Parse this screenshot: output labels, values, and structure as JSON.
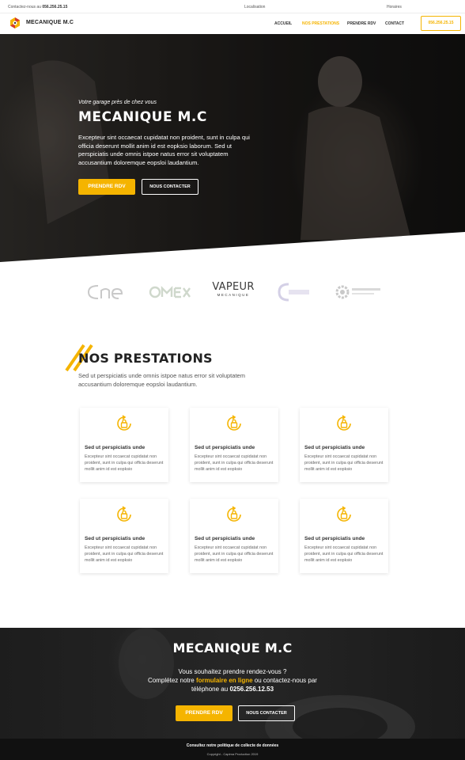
{
  "topbar": {
    "contact_prefix": "Contactez-nous au",
    "contact_phone": "056.256.25.15",
    "location": "Localisation",
    "hours": "Horaires"
  },
  "brand": {
    "name": "MECANIQUE M.C"
  },
  "nav": {
    "items": [
      "ACCUEIL",
      "NOS PRESTATIONS",
      "PRENDRE RDV",
      "CONTACT"
    ],
    "active": "NOS PRESTATIONS",
    "phone": "056.256.25.15"
  },
  "hero": {
    "kicker": "Votre garage près de chez vous",
    "title": "MECANIQUE M.C",
    "text": "Excepteur sint occaecat cupidatat non proident, sunt in culpa qui officia deserunt mollit anim id est eopksio laborum. Sed ut perspiciatis unde omnis istpoe natus error sit voluptatem accusantium doloremque eopsloi laudantium.",
    "primary_button": "PRENDRE RDV",
    "secondary_button": "NOUS CONTACTER"
  },
  "partners": {
    "vapeur_line1": "VAPEUR",
    "vapeur_line2": "MECANIQUE"
  },
  "prestations": {
    "title": "NOS PRESTATIONS",
    "subtitle": "Sed ut perspiciatis unde omnis istpoe natus error sit voluptatem accusantium doloremque eopsloi laudantium.",
    "cards": [
      {
        "title": "Sed ut perspiciatis unde",
        "text": "Excepteur sint occaecat cupidatat non proident, sunt in culpa qui officia deserunt mollit anim id est eopksio"
      },
      {
        "title": "Sed ut perspiciatis unde",
        "text": "Excepteur sint occaecat cupidatat non proident, sunt in culpa qui officia deserunt mollit anim id est eopksio"
      },
      {
        "title": "Sed ut perspiciatis unde",
        "text": "Excepteur sint occaecat cupidatat non proident, sunt in culpa qui officia deserunt mollit anim id est eopksio"
      },
      {
        "title": "Sed ut perspiciatis unde",
        "text": "Excepteur sint occaecat cupidatat non proident, sunt in culpa qui officia deserunt mollit anim id est eopksio"
      },
      {
        "title": "Sed ut perspiciatis unde",
        "text": "Excepteur sint occaecat cupidatat non proident, sunt in culpa qui officia deserunt mollit anim id est eopksio"
      },
      {
        "title": "Sed ut perspiciatis unde",
        "text": "Excepteur sint occaecat cupidatat non proident, sunt in culpa qui officia deserunt mollit anim id est eopksio"
      }
    ]
  },
  "cta": {
    "title": "MECANIQUE M.C",
    "line1": "Vous souhaitez prendre rendez-vous ?",
    "line2_a": "Complétez notre",
    "line2_link": "formulaire en ligne",
    "line2_b": "ou contactez-nous par",
    "line3_a": "téléphone au",
    "line3_phone": "0256.256.12.53",
    "primary_button": "PRENDRE RDV",
    "secondary_button": "NOUS CONTACTER"
  },
  "footer": {
    "policy": "Consultez notre politique de collecte de données",
    "copyright": "Copyright - Capima Production 2019"
  },
  "colors": {
    "accent": "#f5b400",
    "dark": "#111111"
  }
}
